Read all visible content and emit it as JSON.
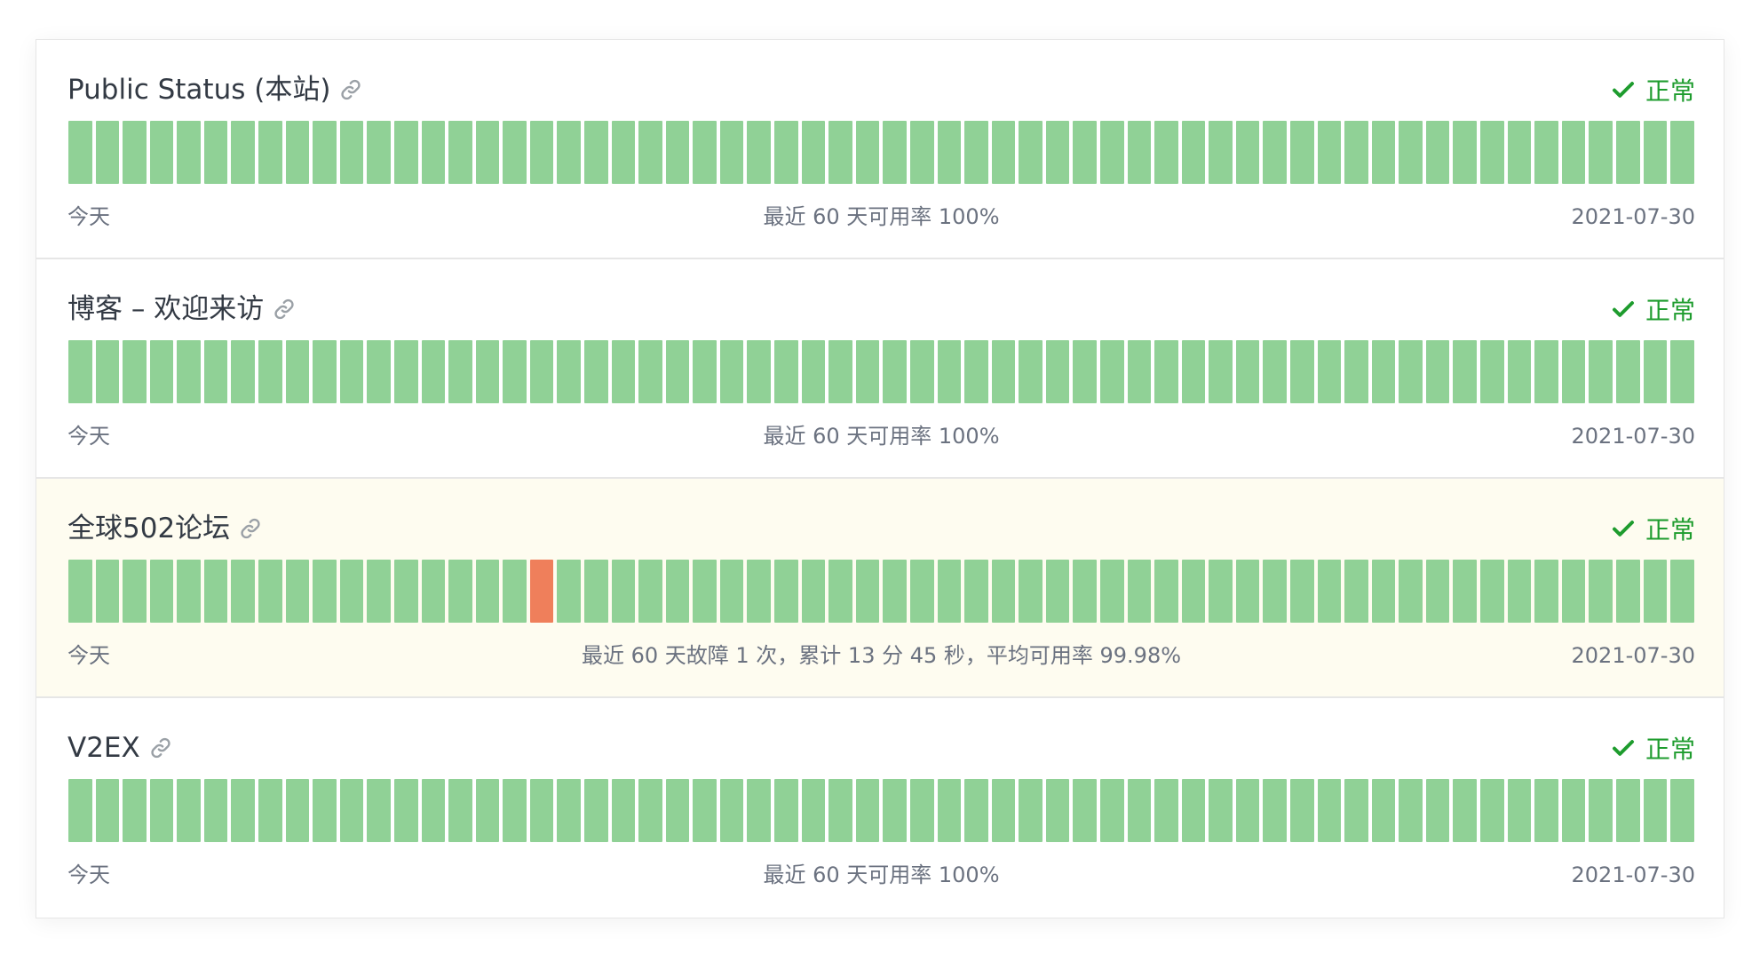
{
  "colors": {
    "up": "#90d196",
    "down": "#ef7f5b",
    "ok": "#1e9c2e",
    "warn_bg": "#fefcf0"
  },
  "icons": {
    "link": "link-icon",
    "status": "check-icon"
  },
  "monitors": [
    {
      "name": "Public Status (本站)",
      "status": "正常",
      "today_label": "今天",
      "summary": "最近 60 天可用率 100%",
      "date": "2021-07-30",
      "bar_count": 60,
      "down_days": []
    },
    {
      "name": "博客 – 欢迎来访",
      "status": "正常",
      "today_label": "今天",
      "summary": "最近 60 天可用率 100%",
      "date": "2021-07-30",
      "bar_count": 60,
      "down_days": []
    },
    {
      "name": "全球502论坛",
      "status": "正常",
      "today_label": "今天",
      "summary": "最近 60 天故障 1 次，累计 13 分 45 秒，平均可用率 99.98%",
      "date": "2021-07-30",
      "bar_count": 60,
      "down_days": [
        17
      ],
      "highlighted": true
    },
    {
      "name": "V2EX",
      "status": "正常",
      "today_label": "今天",
      "summary": "最近 60 天可用率 100%",
      "date": "2021-07-30",
      "bar_count": 60,
      "down_days": []
    }
  ]
}
